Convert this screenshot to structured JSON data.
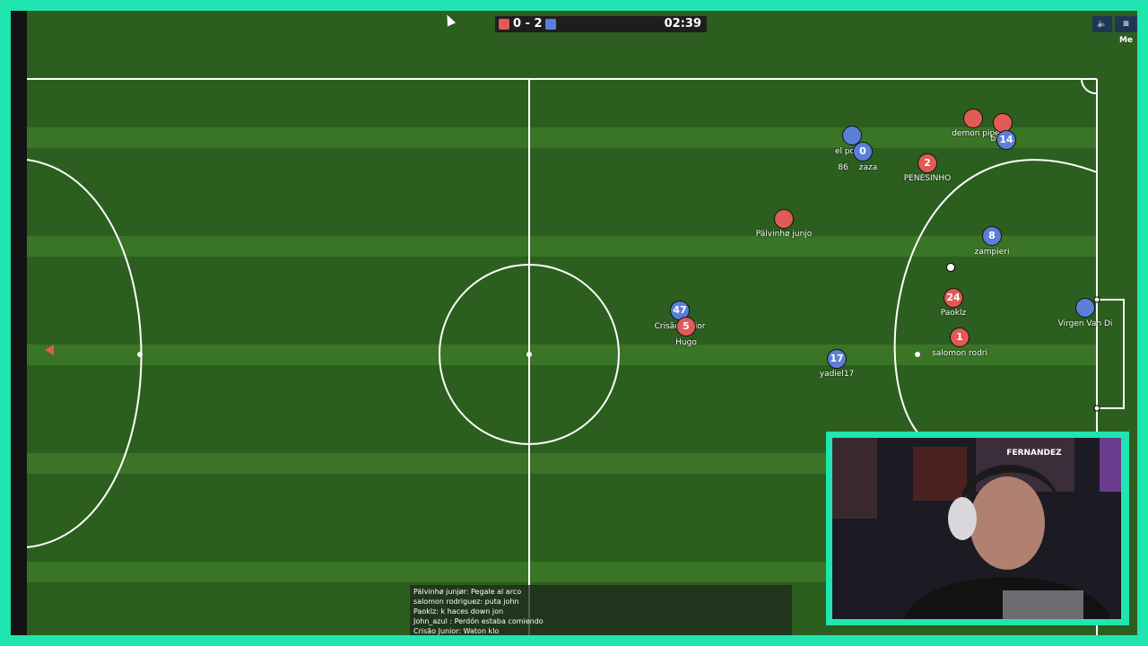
{
  "scoreboard": {
    "score": "0 - 2",
    "timer": "02:39",
    "red_color": "#e05a56",
    "blue_color": "#5b7fd9"
  },
  "controls": {
    "sound_icon": "speaker-icon",
    "menu_label": "≡ Me"
  },
  "players": [
    {
      "number": "",
      "name": "demon pipe",
      "team": "red"
    },
    {
      "number": "",
      "name": "bru",
      "team": "red"
    },
    {
      "number": "14",
      "name": "",
      "team": "blue"
    },
    {
      "number": "",
      "name": "el po",
      "team": "blue"
    },
    {
      "number": "0",
      "name": "zaza",
      "team": "blue"
    },
    {
      "number": "",
      "name": "86",
      "team": "label"
    },
    {
      "number": "2",
      "name": "PENESINHO",
      "team": "red"
    },
    {
      "number": "",
      "name": "Pälvinhø junjo",
      "team": "red"
    },
    {
      "number": "8",
      "name": "zampieri",
      "team": "blue"
    },
    {
      "number": "24",
      "name": "Paoklz",
      "team": "red"
    },
    {
      "number": "1",
      "name": "salomon rodri",
      "team": "red"
    },
    {
      "number": "",
      "name": "Virgen Van Di",
      "team": "blue"
    },
    {
      "number": "47",
      "name": "Crisão Júnior",
      "team": "blue"
    },
    {
      "number": "5",
      "name": "Hugo",
      "team": "red"
    },
    {
      "number": "17",
      "name": "yadiel17",
      "team": "blue"
    }
  ],
  "chat": [
    "Pälvinhø junjør: Pegale al arco",
    "salomon rodriguez: puta john",
    "Paoklz: k haces down jon",
    "John_azul : Perdón estaba comiendo",
    "Crisão Junior: Waton klo"
  ],
  "webcam": {
    "banner_text": "FERNANDEZ"
  }
}
